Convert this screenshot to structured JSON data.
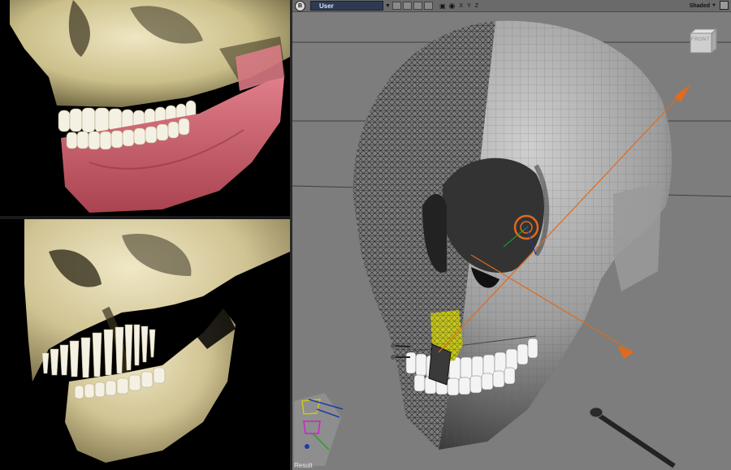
{
  "toolbar": {
    "view_menu_label": "B",
    "camera": "User",
    "axes": [
      "X",
      "Y",
      "Z"
    ],
    "display_mode": "Shaded"
  },
  "nav_cube": {
    "face": "FRONT"
  },
  "footer": {
    "result_label": "Result"
  },
  "colors": {
    "viewport_bg": "#7d7d7d",
    "toolbar_bg": "#6a6a6a",
    "camera_select_bg": "#2f3a52",
    "manipulator": "#e06a1e",
    "selection": "#c8c81e",
    "gum_tissue": "#c45a68",
    "bone": "#d8cfa0"
  }
}
